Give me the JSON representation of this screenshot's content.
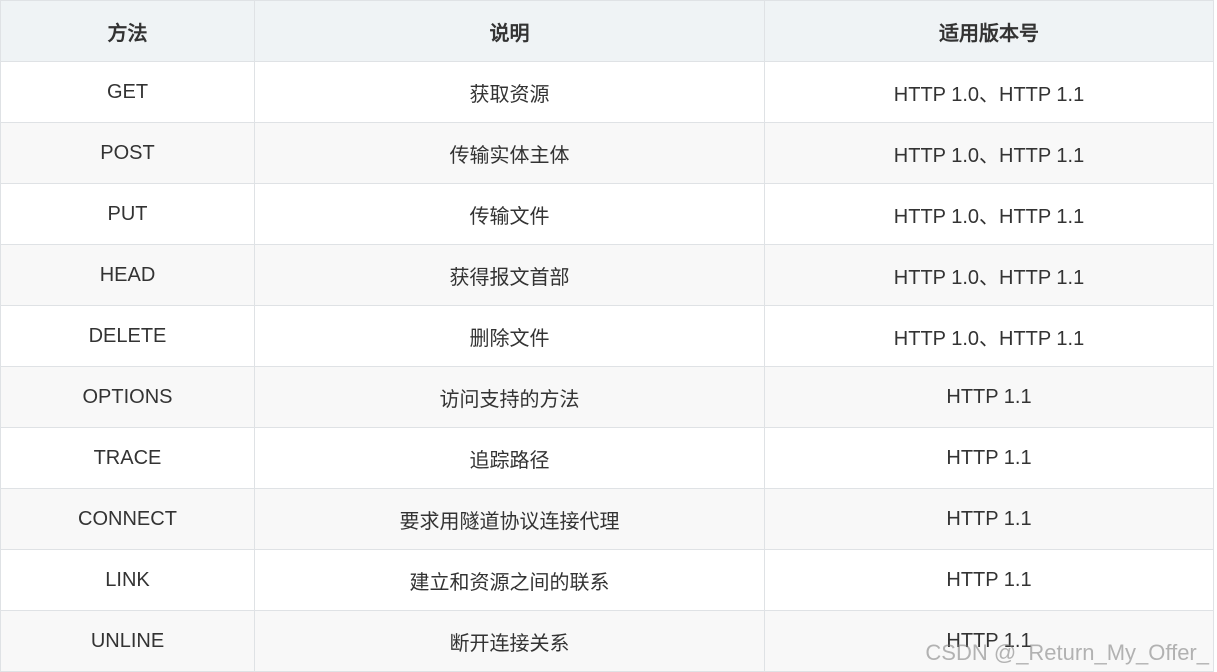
{
  "table": {
    "headers": [
      "方法",
      "说明",
      "适用版本号"
    ],
    "rows": [
      [
        "GET",
        "获取资源",
        "HTTP 1.0、HTTP 1.1"
      ],
      [
        "POST",
        "传输实体主体",
        "HTTP 1.0、HTTP 1.1"
      ],
      [
        "PUT",
        "传输文件",
        "HTTP 1.0、HTTP 1.1"
      ],
      [
        "HEAD",
        "获得报文首部",
        "HTTP 1.0、HTTP 1.1"
      ],
      [
        "DELETE",
        "删除文件",
        "HTTP 1.0、HTTP 1.1"
      ],
      [
        "OPTIONS",
        "访问支持的方法",
        "HTTP 1.1"
      ],
      [
        "TRACE",
        "追踪路径",
        "HTTP 1.1"
      ],
      [
        "CONNECT",
        "要求用隧道协议连接代理",
        "HTTP 1.1"
      ],
      [
        "LINK",
        "建立和资源之间的联系",
        "HTTP 1.1"
      ],
      [
        "UNLINE",
        "断开连接关系",
        "HTTP 1.1"
      ]
    ]
  },
  "watermark": "CSDN @_Return_My_Offer_",
  "colors": {
    "header_bg": "#eff3f5",
    "row_alt_bg": "#f8f8f8",
    "border": "#dfe2e5",
    "text": "#333333"
  }
}
